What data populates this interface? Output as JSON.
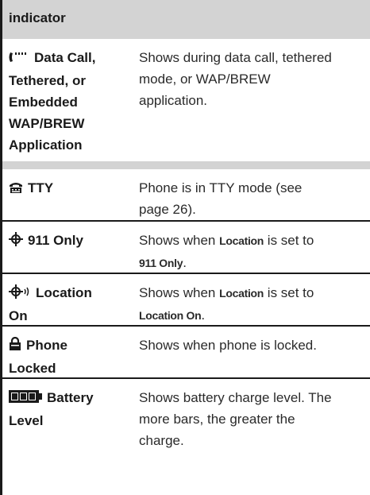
{
  "table": {
    "header": "indicator",
    "rows": [
      {
        "icon": "data-call-icon",
        "name": "Data Call, Tethered, or Embedded WAP/BREW Application",
        "name_lines": [
          "Data Call,",
          "Tethered, or",
          "Embedded",
          "WAP/BREW",
          "Application"
        ],
        "description_lines": [
          "Shows during data call, tethered",
          "mode, or WAP/BREW",
          "application."
        ]
      },
      {
        "icon": "tty-icon",
        "name": "TTY",
        "name_lines": [
          "TTY"
        ],
        "description_lines": [
          "Phone is in TTY mode (see",
          "page 26)."
        ]
      },
      {
        "icon": "location-911-icon",
        "name": "911 Only",
        "name_lines": [
          "911 Only"
        ],
        "description_parts": {
          "line1_a": "Shows when ",
          "line1_b": "Location",
          "line1_c": " is set to",
          "line2_a": "911 Only",
          "line2_b": "."
        }
      },
      {
        "icon": "location-on-icon",
        "name": "Location On",
        "name_lines": [
          "Location",
          "On"
        ],
        "description_parts": {
          "line1_a": "Shows when ",
          "line1_b": "Location",
          "line1_c": " is set to",
          "line2_a": "Location On",
          "line2_b": "."
        }
      },
      {
        "icon": "lock-icon",
        "name": "Phone Locked",
        "name_lines": [
          "Phone",
          "Locked"
        ],
        "description_lines": [
          "Shows when phone is locked."
        ]
      },
      {
        "icon": "battery-icon",
        "name": "Battery Level",
        "name_lines": [
          "Battery",
          "Level"
        ],
        "description_lines": [
          "Shows battery charge level. The",
          "more bars, the greater the",
          "charge."
        ]
      }
    ]
  }
}
